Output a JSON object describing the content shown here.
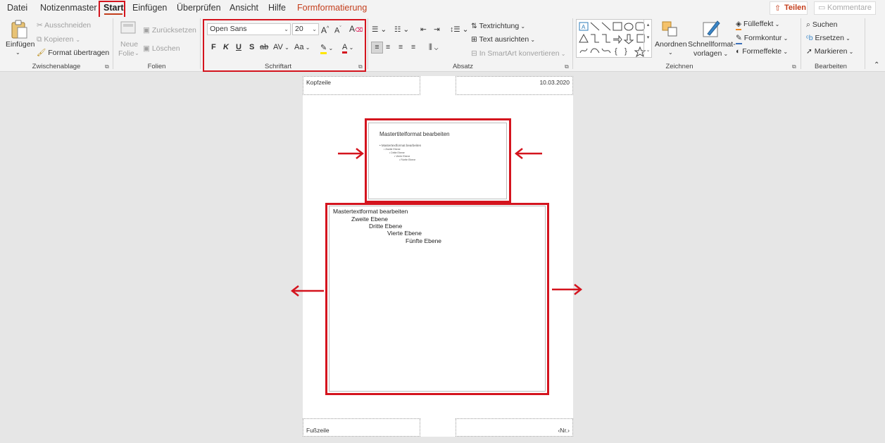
{
  "tabs": {
    "file": "Datei",
    "notes_master": "Notizenmaster",
    "home": "Start",
    "insert": "Einfügen",
    "review": "Überprüfen",
    "view": "Ansicht",
    "help": "Hilfe",
    "shape_format": "Formformatierung"
  },
  "share": {
    "label": "Teilen",
    "icon": "share-icon"
  },
  "comments": {
    "label": "Kommentare",
    "icon": "comment-icon"
  },
  "clipboard": {
    "paste": "Einfügen",
    "cut": "Ausschneiden",
    "copy": "Kopieren",
    "format_painter": "Format übertragen",
    "group": "Zwischenablage"
  },
  "slides": {
    "new_slide_1": "Neue",
    "new_slide_2": "Folie",
    "reset": "Zurücksetzen",
    "delete": "Löschen",
    "group": "Folien"
  },
  "font": {
    "name": "Open Sans",
    "size": "20",
    "bold": "F",
    "italic": "K",
    "underline": "U",
    "shadow": "S",
    "strike": "ab",
    "spacing": "AV",
    "case": "Aa",
    "group": "Schriftart"
  },
  "paragraph": {
    "text_direction": "Textrichtung",
    "align_text": "Text ausrichten",
    "smartart": "In SmartArt konvertieren",
    "group": "Absatz"
  },
  "drawing": {
    "arrange": "Anordnen",
    "quick_styles_1": "Schnellformat-",
    "quick_styles_2": "vorlagen",
    "fill": "Fülleffekt",
    "outline": "Formkontur",
    "effects": "Formeffekte",
    "group": "Zeichnen"
  },
  "editing": {
    "find": "Suchen",
    "replace": "Ersetzen",
    "select": "Markieren",
    "group": "Bearbeiten"
  },
  "page": {
    "header": "Kopfzeile",
    "date": "10.03.2020",
    "footer": "Fußzeile",
    "number": "‹Nr.›"
  },
  "slide_thumb": {
    "title": "Mastertitelformat bearbeiten",
    "l1": "• Mastertextformat bearbeiten",
    "l2": "• Zweite Ebene",
    "l3": "• Dritte Ebene",
    "l4": "• Vierte Ebene",
    "l5": "• Fünfte Ebene"
  },
  "notes": {
    "l1": "Mastertextformat bearbeiten",
    "l2": "Zweite Ebene",
    "l3": "Dritte Ebene",
    "l4": "Vierte Ebene",
    "l5": "Fünfte Ebene"
  },
  "colors": {
    "accent": "#c43e1c",
    "highlight_frame": "#d4141e",
    "ribbon_bg": "#f3f3f3",
    "canvas_bg": "#e6e6e6"
  }
}
